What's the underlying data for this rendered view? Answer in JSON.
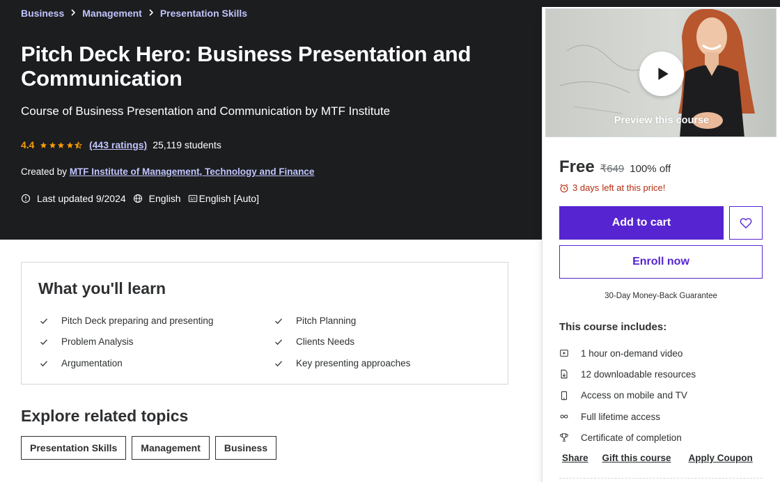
{
  "breadcrumb": [
    "Business",
    "Management",
    "Presentation Skills"
  ],
  "course": {
    "title": "Pitch Deck Hero: Business Presentation and Communication",
    "subtitle": "Course of Business Presentation and Communication by MTF Institute",
    "rating": "4.4",
    "rating_stars": 4.4,
    "ratings_count": "(443 ratings)",
    "students": "25,119 students",
    "created_by_label": "Created by",
    "instructor": "MTF Institute of Management, Technology and Finance",
    "last_updated": "Last updated 9/2024",
    "language": "English",
    "captions": "English [Auto]"
  },
  "sidebar": {
    "preview_label": "Preview this course",
    "price_now": "Free",
    "price_old": "₹649",
    "discount": "100% off",
    "urgency_days": "3 days",
    "urgency_text": "left at this price!",
    "add_to_cart": "Add to cart",
    "enroll": "Enroll now",
    "guarantee": "30-Day Money-Back Guarantee",
    "includes_title": "This course includes:",
    "includes": [
      {
        "icon": "video-icon",
        "text": "1 hour on-demand video"
      },
      {
        "icon": "file-download-icon",
        "text": "12 downloadable resources"
      },
      {
        "icon": "mobile-icon",
        "text": "Access on mobile and TV"
      },
      {
        "icon": "infinity-icon",
        "text": "Full lifetime access"
      },
      {
        "icon": "trophy-icon",
        "text": "Certificate of completion"
      }
    ],
    "actions": [
      "Share",
      "Gift this course",
      "Apply Coupon"
    ]
  },
  "learn": {
    "title": "What you'll learn",
    "items": [
      "Pitch Deck preparing and presenting",
      "Pitch Planning",
      "Problem Analysis",
      "Clients Needs",
      "Argumentation",
      "Key presenting approaches"
    ]
  },
  "explore": {
    "title": "Explore related topics",
    "topics": [
      "Presentation Skills",
      "Management",
      "Business"
    ]
  },
  "colors": {
    "hero_bg": "#1c1d1f",
    "link_purple": "#c0c4fc",
    "brand_purple": "#5624d0",
    "star_orange": "#f69c08",
    "urgency_red": "#b32d0f"
  }
}
